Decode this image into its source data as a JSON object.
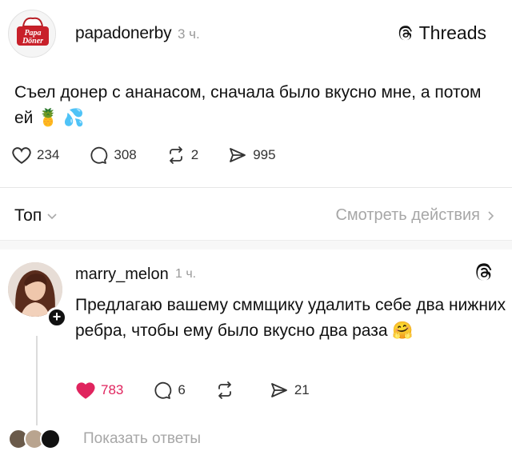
{
  "post": {
    "avatar_label_top": "Papa",
    "avatar_label_bottom": "Döner",
    "handle": "papadonerby",
    "time": "3 ч.",
    "threads_label": "Threads",
    "text": "Съел донер с ананасом, сначала было вкусно мне, а потом ей 🍍 💦",
    "likes": "234",
    "comments": "308",
    "reposts": "2",
    "shares": "995"
  },
  "sort": {
    "top_label": "Топ",
    "view_actions_label": "Смотреть действия"
  },
  "comment": {
    "handle": "marry_melon",
    "time": "1 ч.",
    "text": "Предлагаю вашему сммщику удалить себе два нижних ребра, чтобы ему было вкусно два раза 🤗",
    "likes": "783",
    "comments": "6",
    "reposts": "",
    "shares": "21",
    "like_color": "#e0245e"
  },
  "replies": {
    "label": "Показать ответы"
  }
}
